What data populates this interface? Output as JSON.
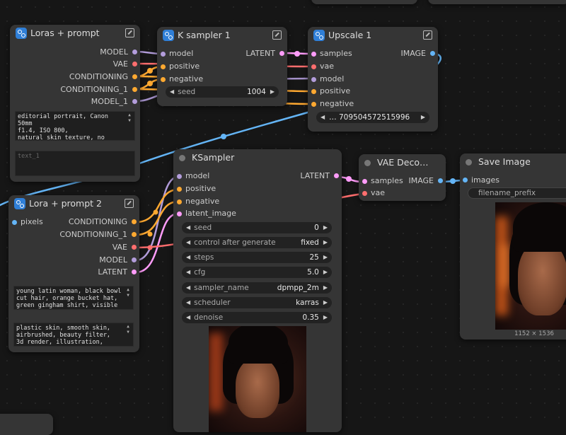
{
  "colors": {
    "model": "#b39ddb",
    "vae": "#ff6e6e",
    "conditioning": "#ffa931",
    "latent": "#ff9cf9",
    "image": "#64b5f6",
    "pixels": "#64b5f6"
  },
  "nodes": {
    "loras_prompt": {
      "title": "Loras + prompt",
      "outputs": [
        "MODEL",
        "VAE",
        "CONDITIONING",
        "CONDITIONING_1",
        "MODEL_1"
      ],
      "text_value": "editorial portrait, Canon 50mm\nf1.4, ISO 800,\nnatural skin texture, no filter",
      "text_placeholder": "text_1"
    },
    "k_sampler_1": {
      "title": "K sampler 1",
      "inputs": [
        "model",
        "positive",
        "negative"
      ],
      "outputs": [
        "LATENT"
      ],
      "seed_label": "seed",
      "seed_value": "1004"
    },
    "upscale_1": {
      "title": "Upscale 1",
      "inputs": [
        "samples",
        "vae",
        "model",
        "positive",
        "negative"
      ],
      "outputs": [
        "IMAGE"
      ],
      "seed_value": "… 709504572515996"
    },
    "lora_prompt_2": {
      "title": "Lora + prompt 2",
      "inputs": [
        "pixels"
      ],
      "outputs": [
        "CONDITIONING",
        "CONDITIONING_1",
        "VAE",
        "MODEL",
        "LATENT"
      ],
      "text_1": "young latin woman, black bowl\ncut hair, orange bucket hat,\ngreen gingham shirt, visible",
      "text_2": "plastic skin, smooth skin,\nairbrushed, beauty filter,\n3d render, illustration,"
    },
    "ksampler": {
      "title": "KSampler",
      "inputs": [
        "model",
        "positive",
        "negative",
        "latent_image"
      ],
      "outputs": [
        "LATENT"
      ],
      "widgets": [
        {
          "label": "seed",
          "value": "0"
        },
        {
          "label": "control after generate",
          "value": "fixed"
        },
        {
          "label": "steps",
          "value": "25"
        },
        {
          "label": "cfg",
          "value": "5.0"
        },
        {
          "label": "sampler_name",
          "value": "dpmpp_2m"
        },
        {
          "label": "scheduler",
          "value": "karras"
        },
        {
          "label": "denoise",
          "value": "0.35"
        }
      ]
    },
    "vae_decode": {
      "title": "VAE Deco…",
      "inputs": [
        "samples",
        "vae"
      ],
      "outputs": [
        "IMAGE"
      ]
    },
    "save_image": {
      "title": "Save Image",
      "inputs": [
        "images"
      ],
      "filename_label": "filename_prefix",
      "image_size": "1152 × 1536"
    }
  }
}
